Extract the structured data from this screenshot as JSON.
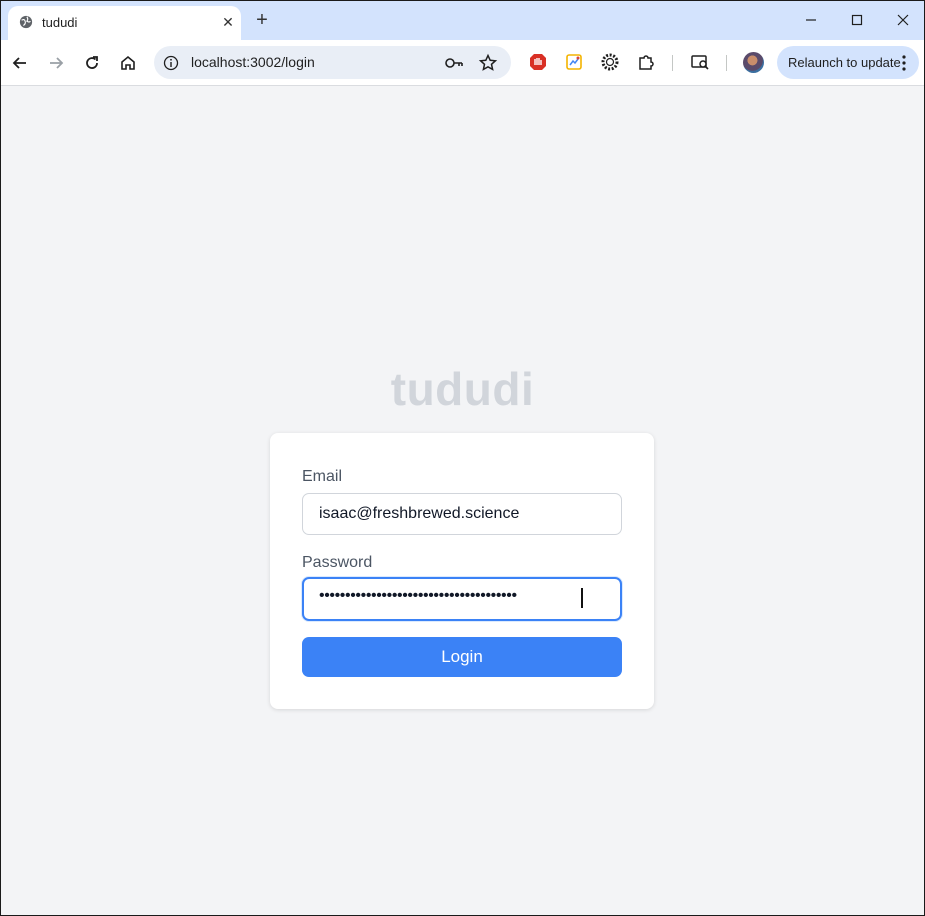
{
  "browser": {
    "tab_title": "tududi",
    "url": "localhost:3002/login",
    "relaunch_label": "Relaunch to update",
    "new_tab_symbol": "+",
    "close_tab_symbol": "✕"
  },
  "page": {
    "brand": "tududi",
    "email_label": "Email",
    "email_value": "isaac@freshbrewed.science",
    "password_label": "Password",
    "password_mask": "••••••••••••••••••••••••••••••••••••••",
    "login_label": "Login"
  },
  "colors": {
    "accent": "#3b82f6",
    "page_background": "#f3f4f6",
    "titlebar": "#d3e3fd"
  },
  "icons": [
    "globe-icon",
    "close-icon",
    "plus-icon",
    "minimize-icon",
    "maximize-icon",
    "window-close-icon",
    "back-icon",
    "forward-icon",
    "reload-icon",
    "home-icon",
    "info-icon",
    "key-icon",
    "star-icon",
    "adblock-icon",
    "extension-colorful-icon",
    "gear-icon",
    "puzzle-icon",
    "tab-search-icon",
    "kebab-icon"
  ]
}
